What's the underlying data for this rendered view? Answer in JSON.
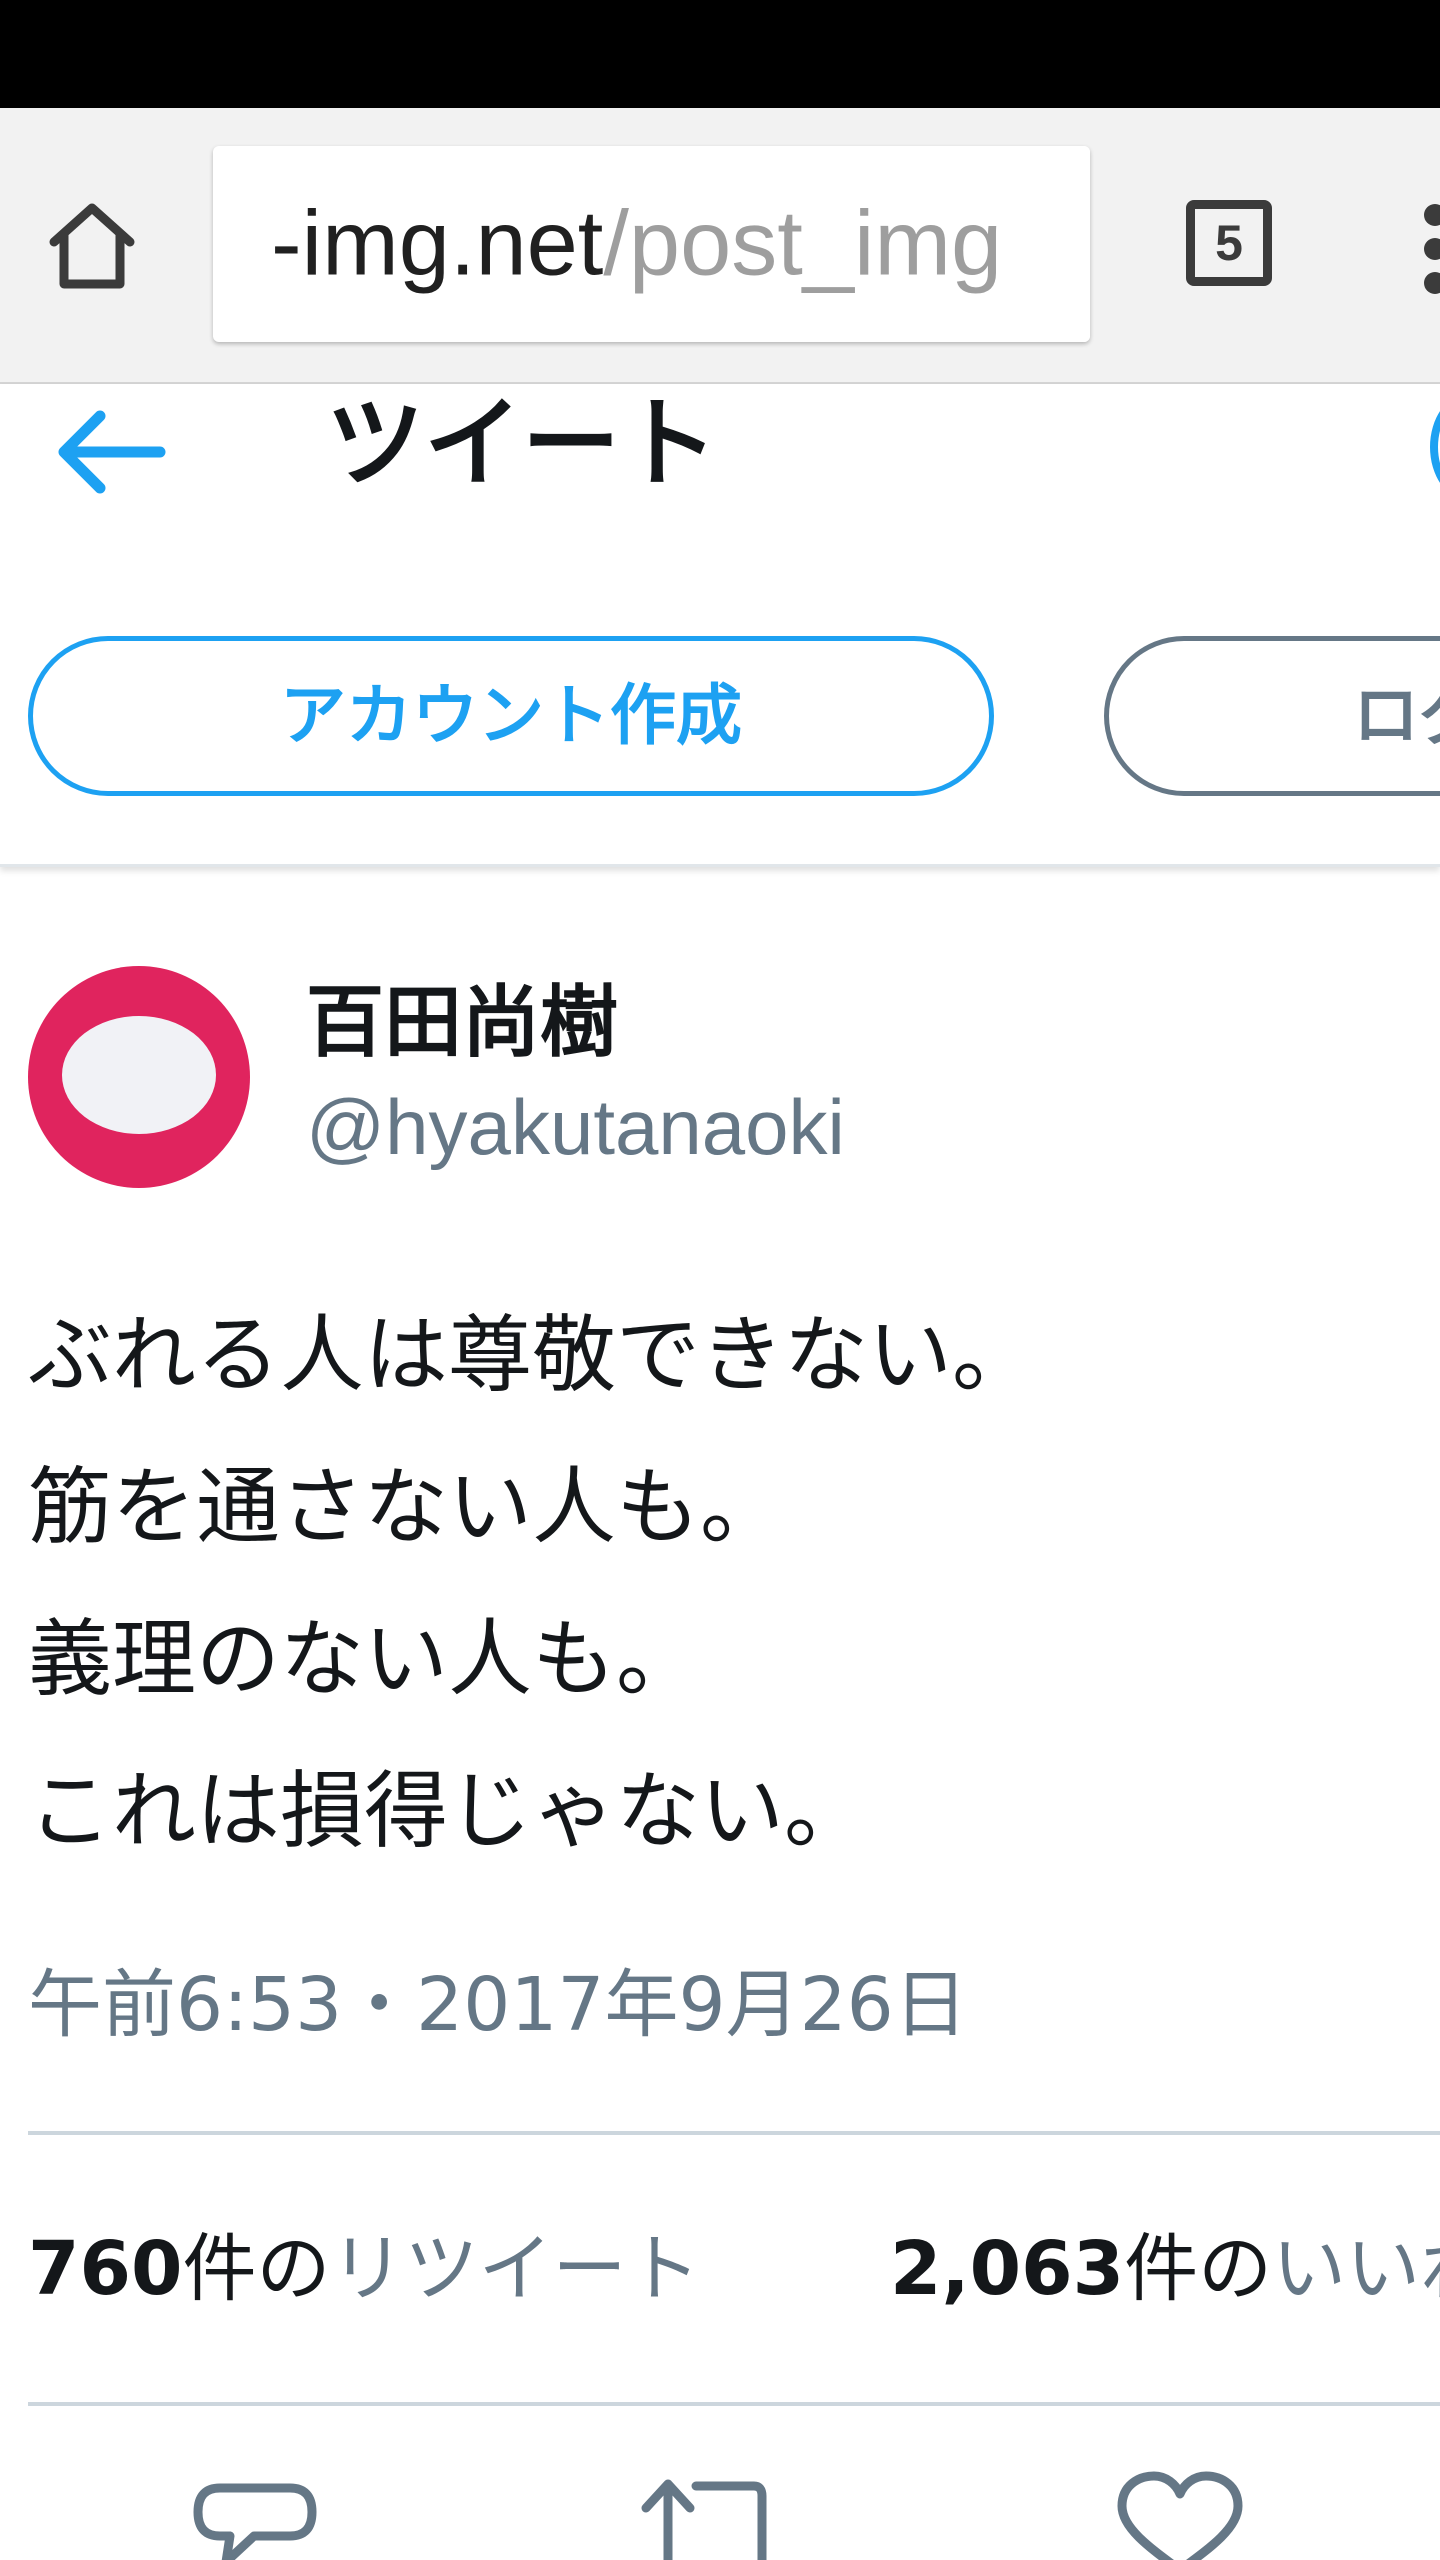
{
  "browser": {
    "url_domain": "-img.net",
    "url_path": "/post_img",
    "tab_count": "5",
    "icons": {
      "home": "home-icon",
      "tabs": "tabs-count-icon",
      "menu": "overflow-menu-icon"
    }
  },
  "header": {
    "title": "ツイート",
    "back_icon": "back-arrow-icon",
    "create_account_label": "アカウント作成",
    "login_label": "ログ"
  },
  "tweet": {
    "display_name": "百田尚樹",
    "handle": "@hyakutanaoki",
    "lines": [
      "ぶれる人は尊敬できない。",
      "筋を通さない人も。",
      "義理のない人も。",
      "これは損得じゃない。"
    ],
    "timestamp": "午前6:53・2017年9月26日",
    "retweets": {
      "count": "760",
      "unit": "件の",
      "label": "リツイート"
    },
    "likes": {
      "count": "2,063",
      "unit": "件の",
      "label": "いいね"
    },
    "action_icons": [
      "reply-icon",
      "retweet-icon",
      "like-icon"
    ]
  },
  "colors": {
    "accent": "#1da1f2",
    "secondary_text": "#657786",
    "avatar": "#e0245e"
  }
}
